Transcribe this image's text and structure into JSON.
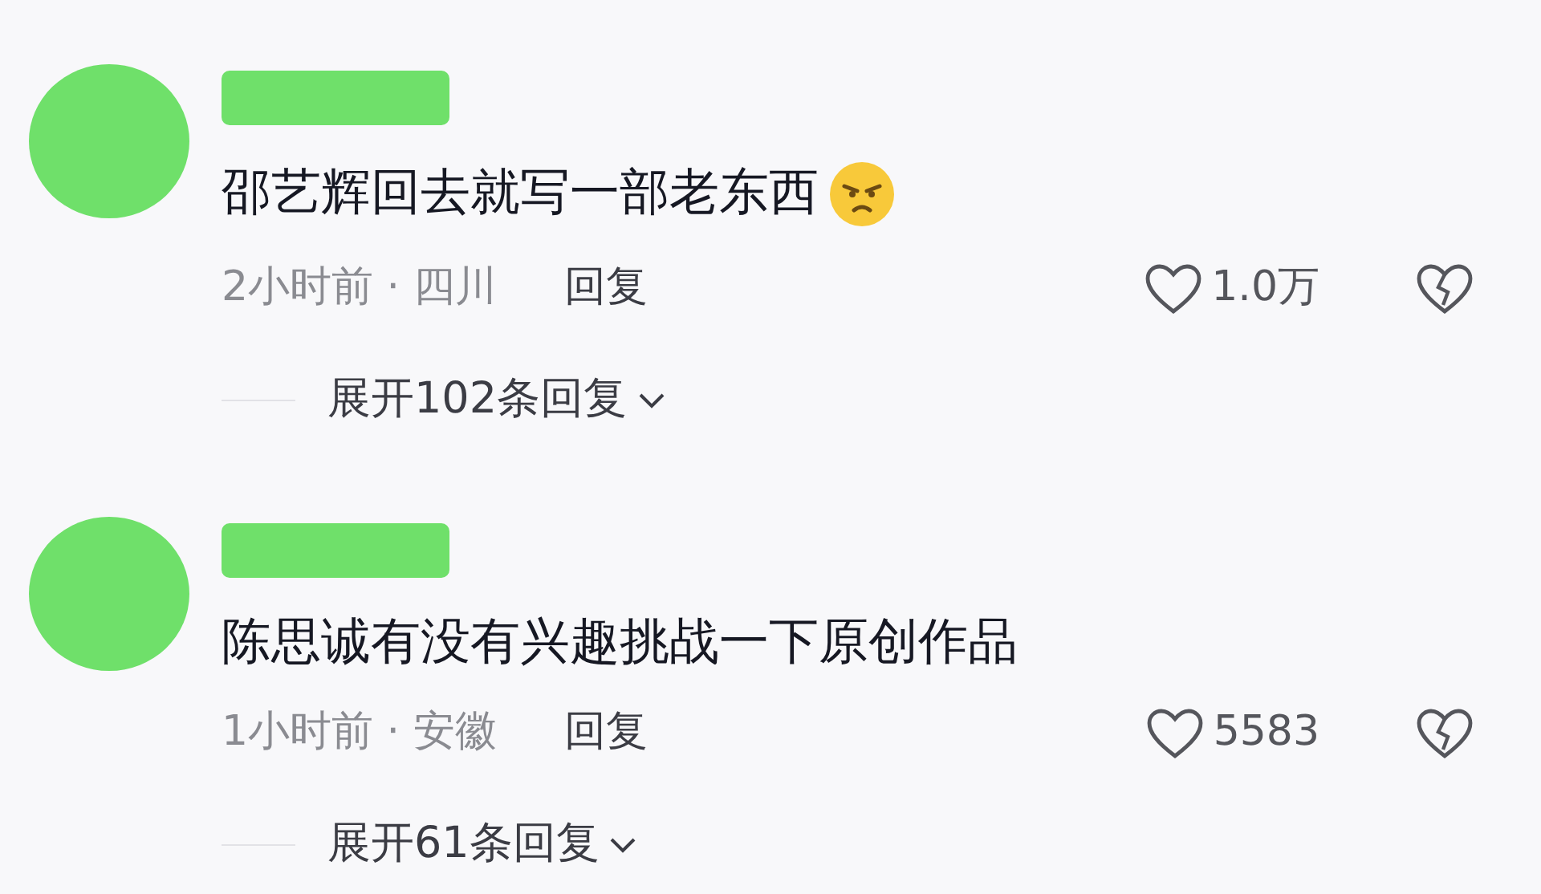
{
  "comments": [
    {
      "text": "邵艺辉回去就写一部老东西",
      "has_emoji": true,
      "time_location": "2小时前 · 四川",
      "reply": "回复",
      "likes": "1.0万",
      "expand": "展开102条回复"
    },
    {
      "text": "陈思诚有没有兴趣挑战一下原创作品",
      "has_emoji": false,
      "time_location": "1小时前 · 安徽",
      "reply": "回复",
      "likes": "5583",
      "expand": "展开61条回复"
    }
  ]
}
